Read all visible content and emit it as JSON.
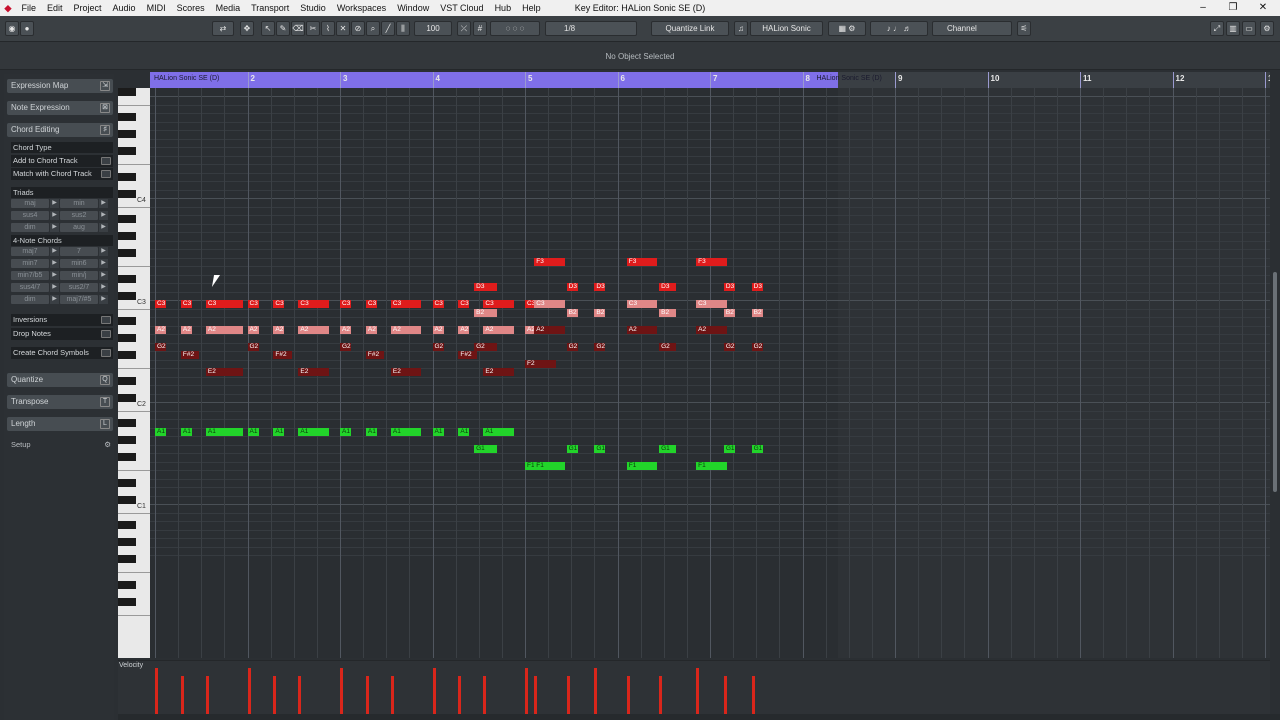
{
  "menubar": {
    "items": [
      "File",
      "Edit",
      "Project",
      "Audio",
      "MIDI",
      "Scores",
      "Media",
      "Transport",
      "Studio",
      "Workspaces",
      "Window",
      "VST Cloud",
      "Hub",
      "Help"
    ],
    "title": "Key Editor: HALion Sonic SE (D)",
    "minimize": "–",
    "restore": "❐",
    "close": "✕"
  },
  "toolbar": {
    "velocity_value": "100",
    "quantize_value": "1/8",
    "quantize_link": "Quantize Link",
    "instrument": "HALion Sonic",
    "channel": "Channel"
  },
  "infoline": {
    "status": "No Object Selected"
  },
  "inspector": {
    "expression_map": "Expression Map",
    "note_expression": "Note Expression",
    "chord_editing": "Chord Editing",
    "chord_type": "Chord Type",
    "add_to_chord_track": "Add to Chord Track",
    "match_with_chord_track": "Match with Chord Track",
    "triads": "Triads",
    "triad_buttons": [
      [
        "maj",
        "min"
      ],
      [
        "sus4",
        "sus2"
      ],
      [
        "dim",
        "aug"
      ]
    ],
    "four_note": "4-Note Chords",
    "four_note_buttons": [
      [
        "maj7",
        "7"
      ],
      [
        "min7",
        "min6"
      ],
      [
        "min7/b5",
        "min/j"
      ],
      [
        "sus4/7",
        "sus2/7"
      ],
      [
        "dim",
        "maj7/#5"
      ]
    ],
    "inversions": "Inversions",
    "drop_notes": "Drop Notes",
    "create_chord_symbols": "Create Chord Symbols",
    "quantize": "Quantize",
    "transpose": "Transpose",
    "length": "Length",
    "setup": "Setup"
  },
  "keyboard": {
    "labels": [
      "C4",
      "C3",
      "C2",
      "C1"
    ]
  },
  "ruler": {
    "bars": [
      "2",
      "3",
      "4",
      "5",
      "6",
      "7",
      "8",
      "9",
      "10",
      "11",
      "12",
      "13"
    ],
    "track_start": "HALion Sonic SE (D)",
    "track_second": "HALion Sonic SE (D)"
  },
  "velocity_label": "Velocity",
  "notes": [
    {
      "p": "F3",
      "s": "red",
      "b": 5.1,
      "l": 0.33
    },
    {
      "p": "F3",
      "s": "red",
      "b": 6.1,
      "l": 0.33
    },
    {
      "p": "F3",
      "s": "red",
      "b": 6.85,
      "l": 0.33
    },
    {
      "p": "D3",
      "s": "red",
      "b": 4.45,
      "l": 0.25
    },
    {
      "p": "D3",
      "s": "red",
      "b": 5.45,
      "l": 0.12
    },
    {
      "p": "D3",
      "s": "red",
      "b": 5.75,
      "l": 0.12
    },
    {
      "p": "D3",
      "s": "red",
      "b": 6.45,
      "l": 0.18
    },
    {
      "p": "D3",
      "s": "red",
      "b": 7.15,
      "l": 0.12
    },
    {
      "p": "D3",
      "s": "red",
      "b": 7.45,
      "l": 0.12
    },
    {
      "p": "C3",
      "s": "red",
      "b": 1.0,
      "l": 0.12
    },
    {
      "p": "C3",
      "s": "red",
      "b": 1.28,
      "l": 0.12
    },
    {
      "p": "C3",
      "s": "red",
      "b": 1.55,
      "l": 0.4
    },
    {
      "p": "C3",
      "s": "red",
      "b": 2.0,
      "l": 0.12
    },
    {
      "p": "C3",
      "s": "red",
      "b": 2.28,
      "l": 0.12
    },
    {
      "p": "C3",
      "s": "red",
      "b": 2.55,
      "l": 0.33
    },
    {
      "p": "C3",
      "s": "red",
      "b": 3.0,
      "l": 0.12
    },
    {
      "p": "C3",
      "s": "red",
      "b": 3.28,
      "l": 0.12
    },
    {
      "p": "C3",
      "s": "red",
      "b": 3.55,
      "l": 0.33
    },
    {
      "p": "C3",
      "s": "red",
      "b": 4.0,
      "l": 0.12
    },
    {
      "p": "C3",
      "s": "red",
      "b": 4.28,
      "l": 0.12
    },
    {
      "p": "C3",
      "s": "red",
      "b": 4.55,
      "l": 0.33
    },
    {
      "p": "C3",
      "s": "red",
      "b": 5.0,
      "l": 0.33
    },
    {
      "p": "C3",
      "s": "pink",
      "b": 5.1,
      "l": 0.33
    },
    {
      "p": "C3",
      "s": "pink",
      "b": 6.1,
      "l": 0.33
    },
    {
      "p": "C3",
      "s": "pink",
      "b": 6.85,
      "l": 0.33
    },
    {
      "p": "B2",
      "s": "pink",
      "b": 4.45,
      "l": 0.25
    },
    {
      "p": "B2",
      "s": "pink",
      "b": 5.45,
      "l": 0.12
    },
    {
      "p": "B2",
      "s": "pink",
      "b": 5.75,
      "l": 0.12
    },
    {
      "p": "B2",
      "s": "pink",
      "b": 6.45,
      "l": 0.18
    },
    {
      "p": "B2",
      "s": "pink",
      "b": 7.15,
      "l": 0.12
    },
    {
      "p": "B2",
      "s": "pink",
      "b": 7.45,
      "l": 0.12
    },
    {
      "p": "A2",
      "s": "pink",
      "b": 1.0,
      "l": 0.12
    },
    {
      "p": "A2",
      "s": "pink",
      "b": 1.28,
      "l": 0.12
    },
    {
      "p": "A2",
      "s": "pink",
      "b": 1.55,
      "l": 0.4
    },
    {
      "p": "A2",
      "s": "pink",
      "b": 2.0,
      "l": 0.12
    },
    {
      "p": "A2",
      "s": "pink",
      "b": 2.28,
      "l": 0.12
    },
    {
      "p": "A2",
      "s": "pink",
      "b": 2.55,
      "l": 0.33
    },
    {
      "p": "A2",
      "s": "pink",
      "b": 3.0,
      "l": 0.12
    },
    {
      "p": "A2",
      "s": "pink",
      "b": 3.28,
      "l": 0.12
    },
    {
      "p": "A2",
      "s": "pink",
      "b": 3.55,
      "l": 0.33
    },
    {
      "p": "A2",
      "s": "pink",
      "b": 4.0,
      "l": 0.12
    },
    {
      "p": "A2",
      "s": "pink",
      "b": 4.28,
      "l": 0.12
    },
    {
      "p": "A2",
      "s": "pink",
      "b": 4.55,
      "l": 0.33
    },
    {
      "p": "A2",
      "s": "pink",
      "b": 5.0,
      "l": 0.33
    },
    {
      "p": "A2",
      "s": "dark",
      "b": 5.1,
      "l": 0.33
    },
    {
      "p": "A2",
      "s": "dark",
      "b": 6.1,
      "l": 0.33
    },
    {
      "p": "A2",
      "s": "dark",
      "b": 6.85,
      "l": 0.33
    },
    {
      "p": "G2",
      "s": "dark",
      "b": 1.0,
      "l": 0.12
    },
    {
      "p": "G2",
      "s": "dark",
      "b": 2.0,
      "l": 0.12
    },
    {
      "p": "G2",
      "s": "dark",
      "b": 3.0,
      "l": 0.12
    },
    {
      "p": "G2",
      "s": "dark",
      "b": 4.0,
      "l": 0.12
    },
    {
      "p": "G2",
      "s": "dark",
      "b": 4.45,
      "l": 0.25
    },
    {
      "p": "G2",
      "s": "dark",
      "b": 5.45,
      "l": 0.12
    },
    {
      "p": "G2",
      "s": "dark",
      "b": 5.75,
      "l": 0.12
    },
    {
      "p": "G2",
      "s": "dark",
      "b": 6.45,
      "l": 0.18
    },
    {
      "p": "G2",
      "s": "dark",
      "b": 7.15,
      "l": 0.12
    },
    {
      "p": "G2",
      "s": "dark",
      "b": 7.45,
      "l": 0.12
    },
    {
      "p": "F#2",
      "s": "dark",
      "b": 1.28,
      "l": 0.2
    },
    {
      "p": "F#2",
      "s": "dark",
      "b": 2.28,
      "l": 0.2
    },
    {
      "p": "F#2",
      "s": "dark",
      "b": 3.28,
      "l": 0.2
    },
    {
      "p": "F#2",
      "s": "dark",
      "b": 4.28,
      "l": 0.2
    },
    {
      "p": "F2",
      "s": "dark",
      "b": 5.0,
      "l": 0.33
    },
    {
      "p": "E2",
      "s": "dark",
      "b": 1.55,
      "l": 0.4
    },
    {
      "p": "E2",
      "s": "dark",
      "b": 2.55,
      "l": 0.33
    },
    {
      "p": "E2",
      "s": "dark",
      "b": 3.55,
      "l": 0.33
    },
    {
      "p": "E2",
      "s": "dark",
      "b": 4.55,
      "l": 0.33
    },
    {
      "p": "A1",
      "s": "green",
      "b": 1.0,
      "l": 0.12
    },
    {
      "p": "A1",
      "s": "green",
      "b": 1.28,
      "l": 0.12
    },
    {
      "p": "A1",
      "s": "green",
      "b": 1.55,
      "l": 0.4
    },
    {
      "p": "A1",
      "s": "green",
      "b": 2.0,
      "l": 0.12
    },
    {
      "p": "A1",
      "s": "green",
      "b": 2.28,
      "l": 0.12
    },
    {
      "p": "A1",
      "s": "green",
      "b": 2.55,
      "l": 0.33
    },
    {
      "p": "A1",
      "s": "green",
      "b": 3.0,
      "l": 0.12
    },
    {
      "p": "A1",
      "s": "green",
      "b": 3.28,
      "l": 0.12
    },
    {
      "p": "A1",
      "s": "green",
      "b": 3.55,
      "l": 0.33
    },
    {
      "p": "A1",
      "s": "green",
      "b": 4.0,
      "l": 0.12
    },
    {
      "p": "A1",
      "s": "green",
      "b": 4.28,
      "l": 0.12
    },
    {
      "p": "A1",
      "s": "green",
      "b": 4.55,
      "l": 0.33
    },
    {
      "p": "G1",
      "s": "green",
      "b": 4.45,
      "l": 0.25
    },
    {
      "p": "G1",
      "s": "green",
      "b": 5.45,
      "l": 0.12
    },
    {
      "p": "G1",
      "s": "green",
      "b": 5.75,
      "l": 0.12
    },
    {
      "p": "G1",
      "s": "green",
      "b": 6.45,
      "l": 0.18
    },
    {
      "p": "G1",
      "s": "green",
      "b": 7.15,
      "l": 0.12
    },
    {
      "p": "G1",
      "s": "green",
      "b": 7.45,
      "l": 0.12
    },
    {
      "p": "F1",
      "s": "green",
      "b": 5.0,
      "l": 0.33
    },
    {
      "p": "F1",
      "s": "green",
      "b": 5.1,
      "l": 0.33
    },
    {
      "p": "F1",
      "s": "green",
      "b": 6.1,
      "l": 0.33
    },
    {
      "p": "F1",
      "s": "green",
      "b": 6.85,
      "l": 0.33
    }
  ],
  "velocity_bars": [
    1.0,
    1.28,
    1.55,
    2.0,
    2.28,
    2.55,
    3.0,
    3.28,
    3.55,
    4.0,
    4.28,
    4.55,
    5.0,
    5.45,
    5.1,
    5.75,
    6.1,
    6.45,
    6.85,
    7.15,
    7.45
  ],
  "colors": {
    "red": "#e01c1c",
    "pink": "#e08787",
    "dark": "#6e1414",
    "green": "#22d42a",
    "event_bar": "#7f6fe8"
  }
}
